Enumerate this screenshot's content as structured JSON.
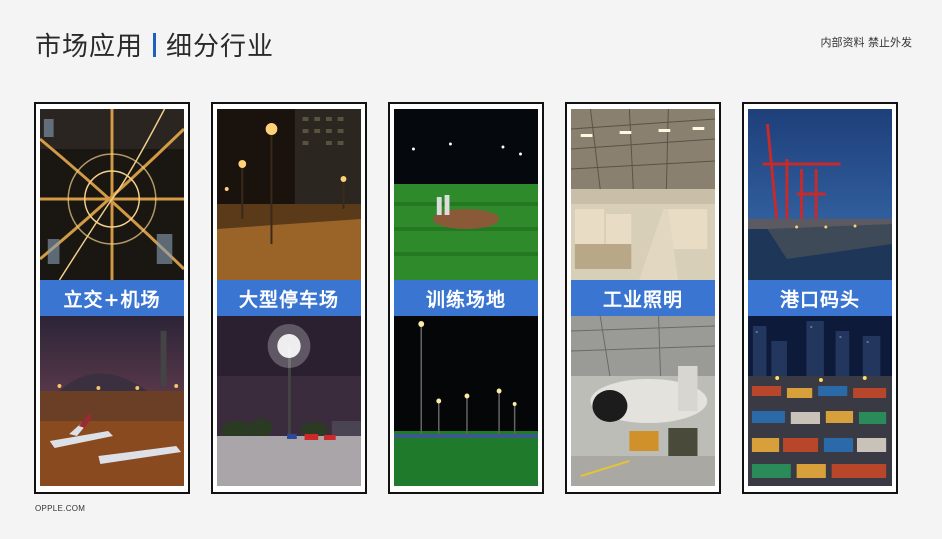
{
  "header": {
    "title_main": "市场应用",
    "title_sub": "细分行业",
    "confidential": "内部资料 禁止外发"
  },
  "footer": {
    "site": "OPPLE.COM"
  },
  "cards": [
    {
      "label": "立交+机场",
      "top_image": "highway-interchange-night-photo",
      "bottom_image": "airport-night-photo"
    },
    {
      "label": "大型停车场",
      "top_image": "parking-lot-night-photo",
      "bottom_image": "parking-lot-floodlight-photo"
    },
    {
      "label": "训练场地",
      "top_image": "baseball-field-night-photo",
      "bottom_image": "sports-field-floodlight-photo"
    },
    {
      "label": "工业照明",
      "top_image": "warehouse-interior-photo",
      "bottom_image": "aircraft-hangar-photo"
    },
    {
      "label": "港口码头",
      "top_image": "port-crane-photo",
      "bottom_image": "container-terminal-photo"
    }
  ],
  "colors": {
    "accent": "#1f5fbf",
    "label_bg": "#3a76d1"
  }
}
